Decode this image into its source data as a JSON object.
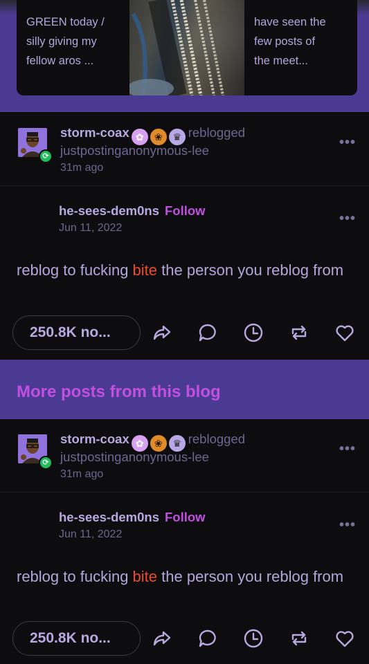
{
  "top_cards": {
    "left_text": [
      "GREEN today /",
      "silly giving my",
      "fellow aros ..."
    ],
    "right_text": [
      "have seen the",
      "few posts of",
      "the meet..."
    ]
  },
  "posts": [
    {
      "reblogger": "storm-coax",
      "reblog_verb": "reblogged",
      "source": "justpostinganonymous-lee",
      "reblog_time": "31m ago",
      "op": "he-sees-dem0ns",
      "follow_label": "Follow",
      "date": "Jun 11, 2022",
      "text_before": "reblog to fucking ",
      "text_highlight": "bite",
      "text_after": " the person you reblog from",
      "notes": "250.8K",
      "notes_suffix": "no...",
      "menu": "•••"
    },
    {
      "reblogger": "storm-coax",
      "reblog_verb": "reblogged",
      "source": "justpostinganonymous-lee",
      "reblog_time": "31m ago",
      "op": "he-sees-dem0ns",
      "follow_label": "Follow",
      "date": "Jun 11, 2022",
      "text_before": "reblog to fucking ",
      "text_highlight": "bite",
      "text_after": " the person you reblog from",
      "notes": "250.8K",
      "notes_suffix": "no...",
      "menu": "•••"
    }
  ],
  "banner": {
    "title": "More posts from this blog"
  },
  "colors": {
    "accent_purple": "#4b3a92",
    "follow_magenta": "#c14fe0",
    "highlight_red": "#f04a2e",
    "badge_green": "#1fbe5a",
    "background": "#0d0d10"
  },
  "icons": [
    "share-icon",
    "reply-icon",
    "clock-icon",
    "reblog-icon",
    "heart-icon",
    "more-options-icon"
  ]
}
